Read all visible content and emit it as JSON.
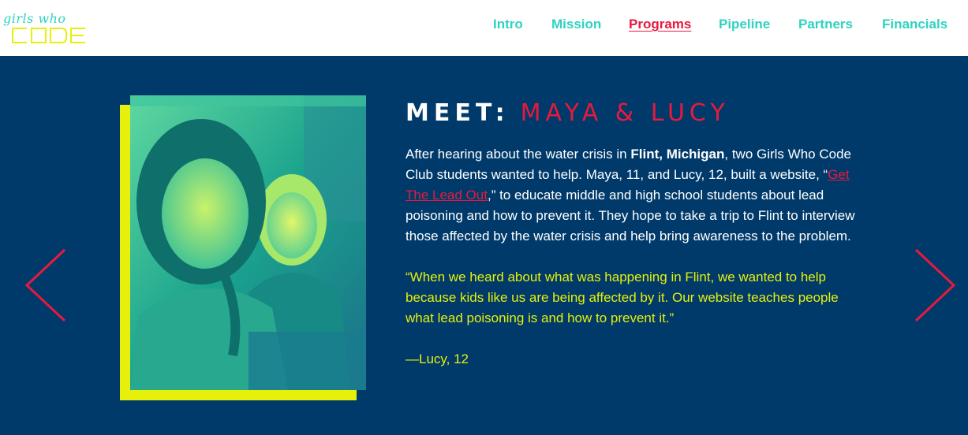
{
  "header": {
    "logo": {
      "script": "girls who",
      "word": "code"
    },
    "nav": [
      {
        "label": "Intro"
      },
      {
        "label": "Mission"
      },
      {
        "label": "Programs",
        "active": true
      },
      {
        "label": "Pipeline"
      },
      {
        "label": "Partners"
      },
      {
        "label": "Financials"
      }
    ]
  },
  "feature": {
    "title_lead": "MEET:",
    "title_names": "MAYA & LUCY",
    "body": {
      "part1": "After hearing about the water crisis in ",
      "place": "Flint, Michigan",
      "part2": ", two Girls Who Code Club students wanted to help. Maya, 11, and Lucy, 12, built a website, “",
      "link": "Get The Lead Out",
      "part3": ",” to educate middle and high school students about lead poisoning and how to prevent it. They hope to take a trip to Flint to interview those affected by the water crisis and help bring awareness to the problem."
    },
    "quote": "“When we heard about what was happening in Flint, we wanted to help because kids like us are being affected by it. Our website teaches people what lead poisoning is and how to prevent it.”",
    "attribution": "—Lucy, 12"
  },
  "controls": {
    "prev_icon": "chevron-left-icon",
    "next_icon": "chevron-right-icon"
  },
  "colors": {
    "background": "#003a6b",
    "accent_red": "#e8193d",
    "accent_teal": "#2fd2c1",
    "accent_yellow": "#e6f00a"
  }
}
